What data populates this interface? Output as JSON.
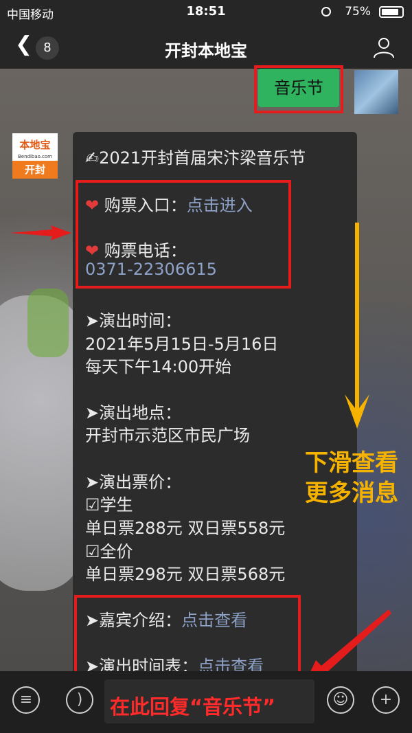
{
  "status_bar": {
    "carrier": "中国移动",
    "time": "18:51",
    "battery": "75%"
  },
  "nav": {
    "back_icon": "chevron-left-icon",
    "unread_count": "8",
    "title": "开封本地宝",
    "profile_icon": "user-icon"
  },
  "sent_message": {
    "text": "音乐节"
  },
  "account_logo": {
    "top": "本地宝",
    "url": "Bendibao.com",
    "bottom": "开封"
  },
  "message": {
    "title": "✍2021开封首届宋汴梁音乐节",
    "ticket_entry_label": "购票入口：",
    "ticket_entry_link": "点击进入",
    "ticket_phone_label": "购票电话：",
    "ticket_phone": "0371-22306615",
    "time_label": "➤演出时间：",
    "time_date": "2021年5月15日-5月16日",
    "time_daily": "每天下午14:00开始",
    "place_label": "➤演出地点：",
    "place": "开封市示范区市民广场",
    "price_label": "➤演出票价：",
    "student_label": "☑学生",
    "student_price": "单日票288元 双日票558元",
    "full_label": "☑全价",
    "full_price": "单日票298元 双日票568元",
    "guest_label": "➤嘉宾介绍：",
    "guest_link": "点击查看",
    "schedule_label": "➤演出时间表：",
    "schedule_link": "点击查看"
  },
  "hints": {
    "scroll_line1": "下滑查看",
    "scroll_line2": "更多消息"
  },
  "input_bar": {
    "menu_icon": "menu-icon",
    "voice_icon": "voice-icon",
    "input_text": "在此回复“音乐节”",
    "emoji_icon": "emoji-icon",
    "plus_icon": "plus-icon"
  },
  "colors": {
    "highlight_red": "#e51c1c",
    "hint_yellow": "#f5b300",
    "link_blue": "#8ea2c8",
    "sent_green": "#2fb35e"
  }
}
